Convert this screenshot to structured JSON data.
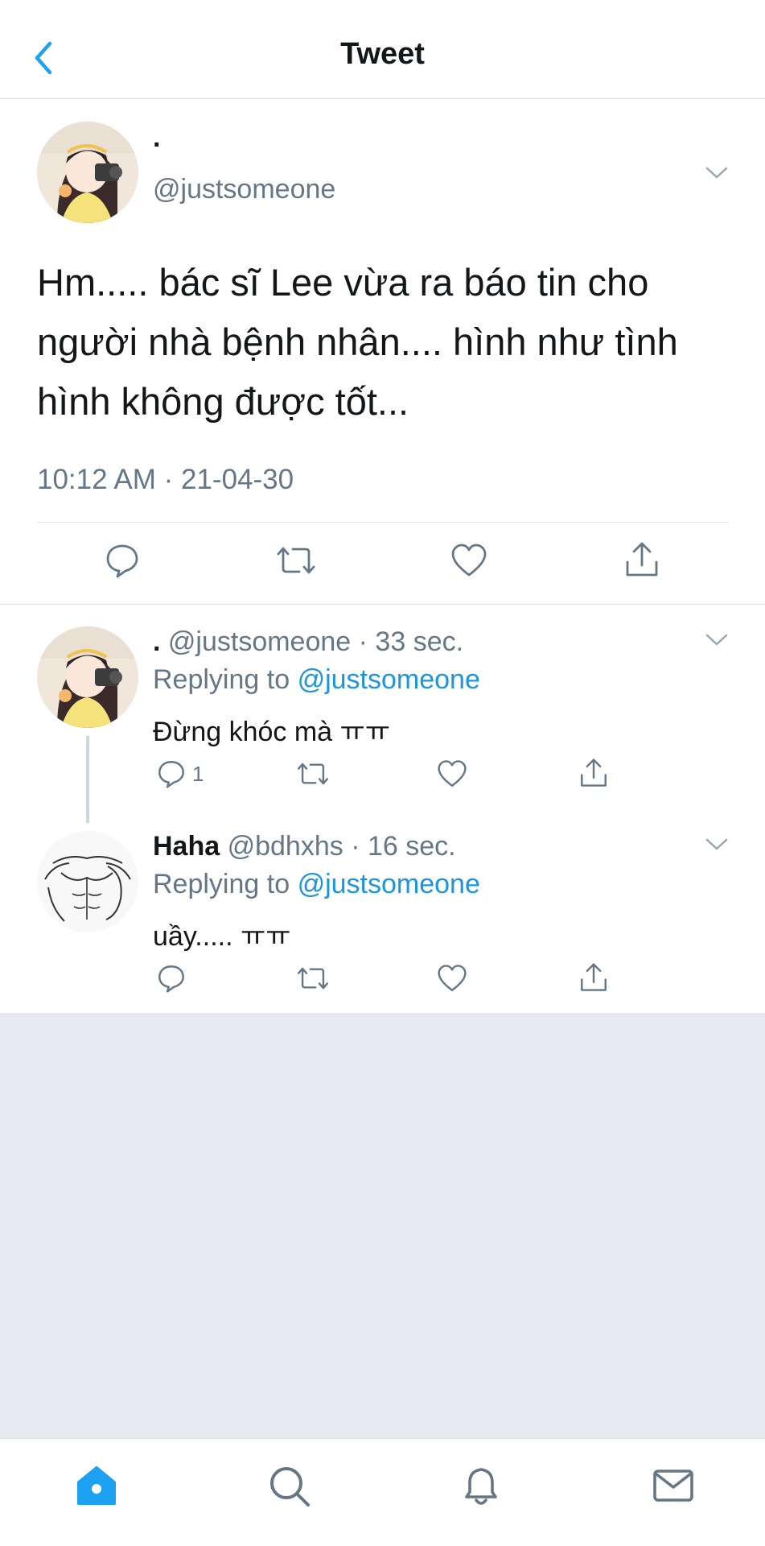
{
  "header": {
    "title": "Tweet"
  },
  "main_tweet": {
    "display_name": ".",
    "handle": "@justsomeone",
    "text": "Hm..... bác sĩ Lee vừa ra báo tin cho người nhà bệnh nhân.... hình như tình hình không được tốt...",
    "timestamp": "10:12 AM · 21-04-30"
  },
  "replies": [
    {
      "display_name": ".",
      "handle": "@justsomeone",
      "time": "· 33 sec.",
      "replying_prefix": "Replying to",
      "replying_to": "@justsomeone",
      "text": "Đừng khóc mà ㅠㅠ",
      "reply_count": "1"
    },
    {
      "display_name": "Haha",
      "handle": "@bdhxhs",
      "time": "· 16 sec.",
      "replying_prefix": "Replying to",
      "replying_to": "@justsomeone",
      "text": "uầy..... ㅠㅠ",
      "reply_count": ""
    }
  ],
  "colors": {
    "accent": "#1da1f2",
    "link": "#1b95e0",
    "secondary_text": "#657786",
    "empty_bg": "#e6e9ee"
  },
  "tabbar": {
    "icons": [
      "home-icon",
      "search-icon",
      "bell-icon",
      "mail-icon"
    ],
    "active": "home-icon"
  }
}
